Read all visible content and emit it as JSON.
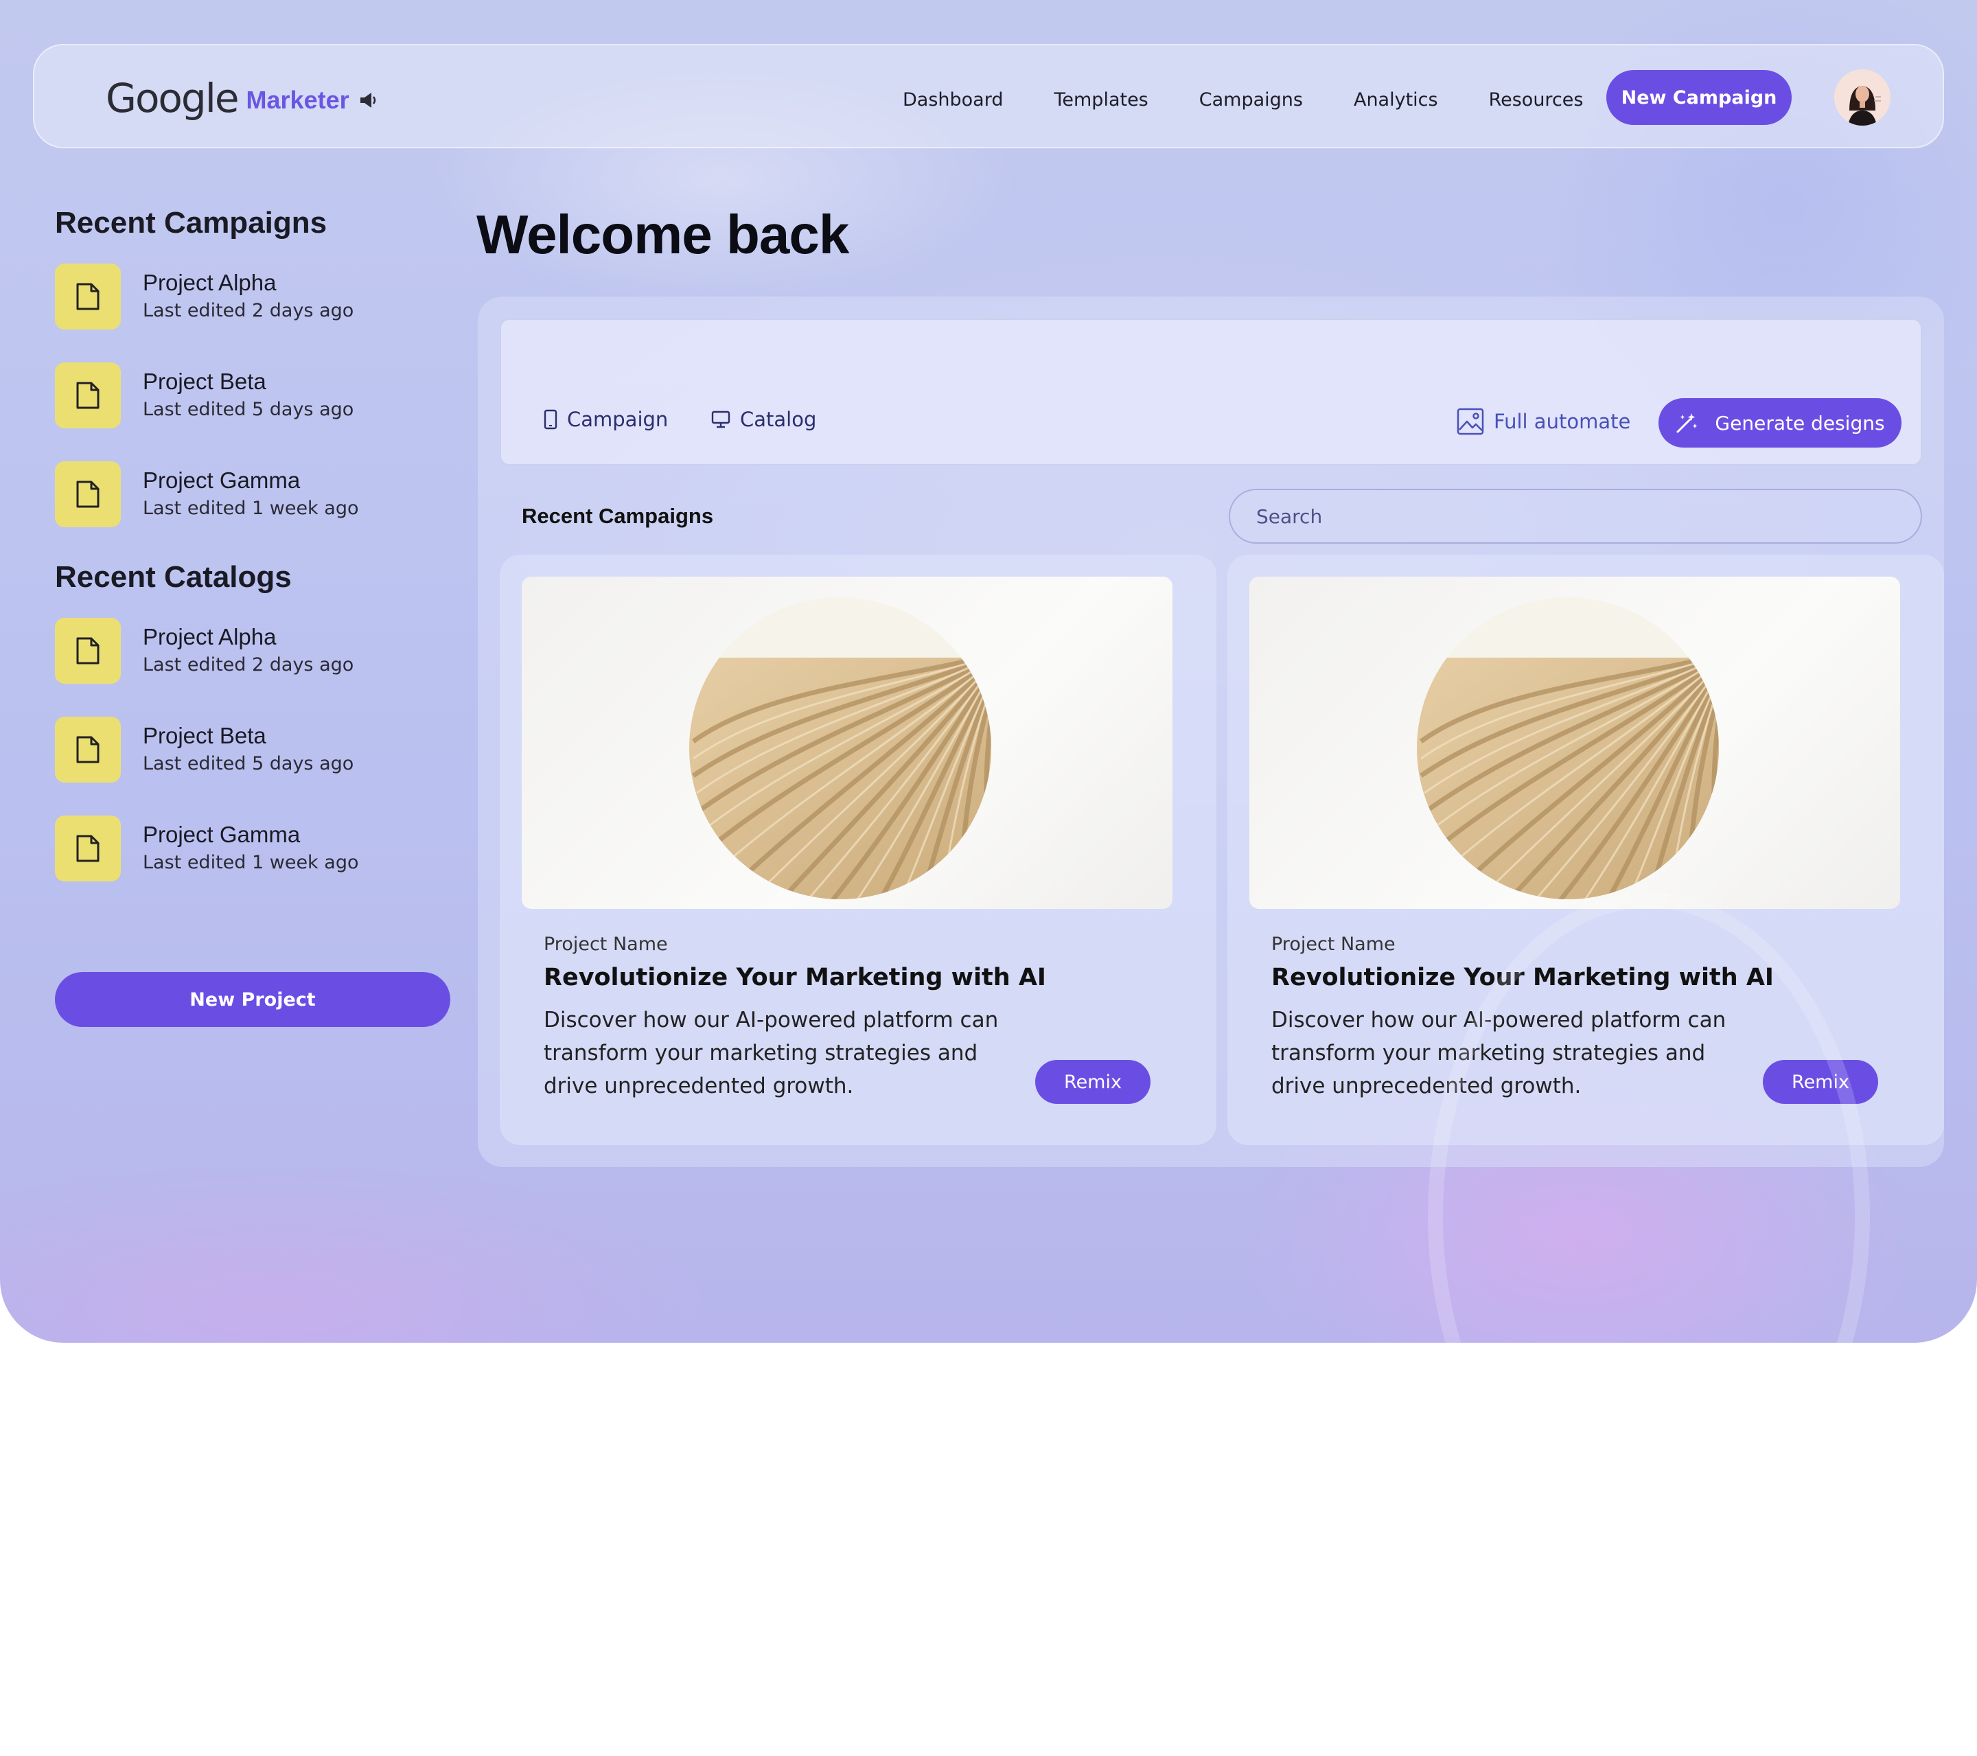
{
  "header": {
    "logo_google": "Google",
    "logo_marketer": "Marketer",
    "nav": [
      "Dashboard",
      "Templates",
      "Campaigns",
      "Analytics",
      "Resources"
    ],
    "cta": "New Campaign"
  },
  "sidebar": {
    "campaigns_heading": "Recent Campaigns",
    "campaigns": [
      {
        "title": "Project Alpha",
        "sub": "Last edited 2 days ago"
      },
      {
        "title": "Project Beta",
        "sub": "Last edited 5 days ago"
      },
      {
        "title": "Project Gamma",
        "sub": "Last edited 1 week ago"
      }
    ],
    "catalogs_heading": "Recent Catalogs",
    "catalogs": [
      {
        "title": "Project Alpha",
        "sub": "Last edited 2 days ago"
      },
      {
        "title": "Project Beta",
        "sub": "Last edited 5 days ago"
      },
      {
        "title": "Project Gamma",
        "sub": "Last edited 1 week ago"
      }
    ],
    "new_project": "New Project"
  },
  "main": {
    "welcome": "Welcome back",
    "composer": {
      "tab_campaign": "Campaign",
      "tab_catalog": "Catalog",
      "full_automate": "Full automate",
      "generate": "Generate designs"
    },
    "recent_heading": "Recent Campaigns",
    "search_placeholder": "Search",
    "cards": [
      {
        "label": "Project Name",
        "title": "Revolutionize Your Marketing with AI",
        "desc": "Discover how our AI-powered platform can transform your marketing strategies and drive unprecedented growth.",
        "action": "Remix"
      },
      {
        "label": "Project Name",
        "title": "Revolutionize Your Marketing with AI",
        "desc": "Discover how our AI-powered platform can transform your marketing strategies and drive unprecedented growth.",
        "action": "Remix"
      }
    ]
  },
  "colors": {
    "accent": "#6a4ee4",
    "tile": "#ecdf72",
    "brand_marketer": "#6957e2"
  },
  "icons": [
    "speaker-icon",
    "document-icon",
    "phone-icon",
    "monitor-icon",
    "image-icon",
    "magic-wand-icon"
  ]
}
